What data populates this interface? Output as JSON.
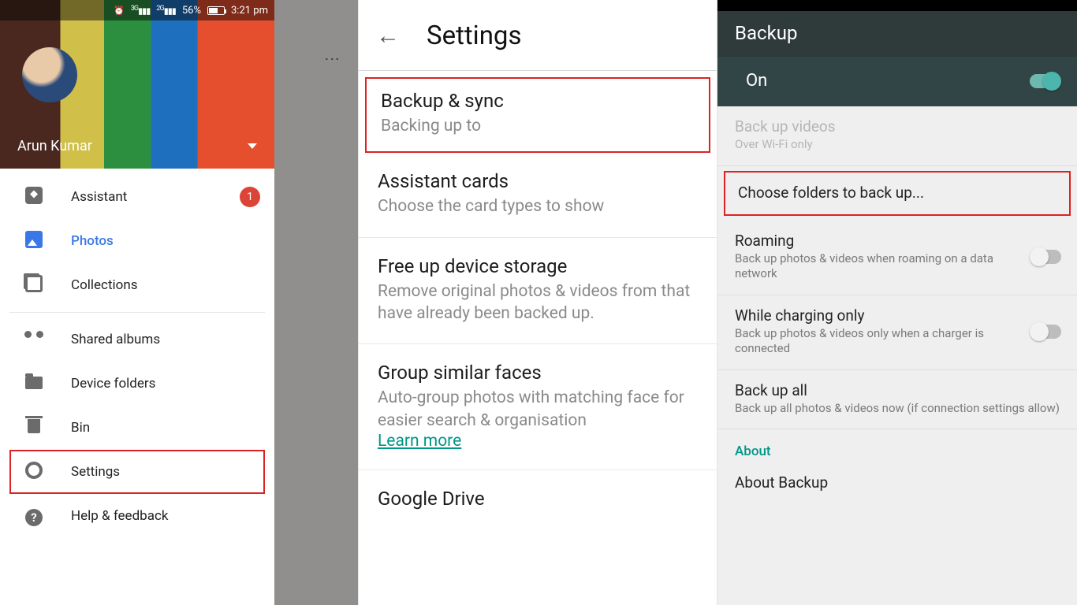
{
  "panel1": {
    "status": {
      "net1": "3G",
      "net2": "2G",
      "battery_pct": "56%",
      "time": "3:21 pm"
    },
    "user_name": "Arun Kumar",
    "nav": {
      "assistant": "Assistant",
      "assistant_badge": "1",
      "photos": "Photos",
      "collections": "Collections",
      "shared": "Shared albums",
      "device_folders": "Device folders",
      "bin": "Bin",
      "settings": "Settings",
      "help": "Help & feedback"
    }
  },
  "panel2": {
    "title": "Settings",
    "rows": {
      "backup": {
        "title": "Backup & sync",
        "sub": "Backing up to"
      },
      "assistant": {
        "title": "Assistant cards",
        "sub": "Choose the card types to show"
      },
      "freeup": {
        "title": "Free up device storage",
        "sub": "Remove original photos & videos from that have already been backed up."
      },
      "faces": {
        "title": "Group similar faces",
        "sub": "Auto-group photos with matching face for easier search & organisation",
        "link": "Learn more"
      },
      "drive": {
        "title": "Google Drive"
      }
    }
  },
  "panel3": {
    "appbar": "Backup",
    "on_label": "On",
    "rows": {
      "videos": {
        "title": "Back up videos",
        "sub": "Over Wi-Fi only"
      },
      "choose": {
        "title": "Choose folders to back up..."
      },
      "roaming": {
        "title": "Roaming",
        "sub": "Back up photos & videos when roaming on a data network"
      },
      "charging": {
        "title": "While charging only",
        "sub": "Back up photos & videos only when a charger is connected"
      },
      "backup_all": {
        "title": "Back up all",
        "sub": "Back up all photos & videos now (if connection settings allow)"
      }
    },
    "about_header": "About",
    "about_row": "About Backup"
  }
}
